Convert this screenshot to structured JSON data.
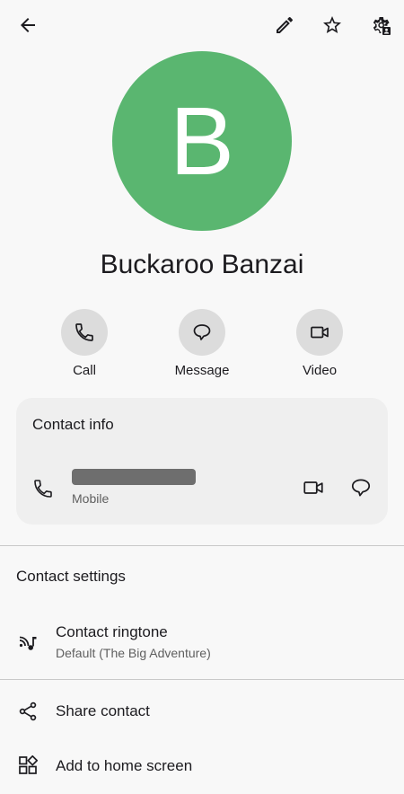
{
  "toolbar": {
    "back_icon": "arrow-back-icon",
    "edit_icon": "pencil-icon",
    "favorite_icon": "star-icon",
    "settings_icon": "contact-settings-icon"
  },
  "contact": {
    "initial": "B",
    "name": "Buckaroo Banzai",
    "avatar_color": "#5ab670"
  },
  "actions": [
    {
      "label": "Call",
      "icon": "phone-icon"
    },
    {
      "label": "Message",
      "icon": "message-icon"
    },
    {
      "label": "Video",
      "icon": "video-icon"
    }
  ],
  "contact_info": {
    "title": "Contact info",
    "phone_type": "Mobile"
  },
  "contact_settings": {
    "title": "Contact settings",
    "ringtone_title": "Contact ringtone",
    "ringtone_value": "Default (The Big Adventure)",
    "share_label": "Share contact",
    "home_label": "Add to home screen"
  },
  "colors": {
    "background": "#f8f8f8",
    "card": "#efefef",
    "action_circle": "#dcdcdc"
  }
}
